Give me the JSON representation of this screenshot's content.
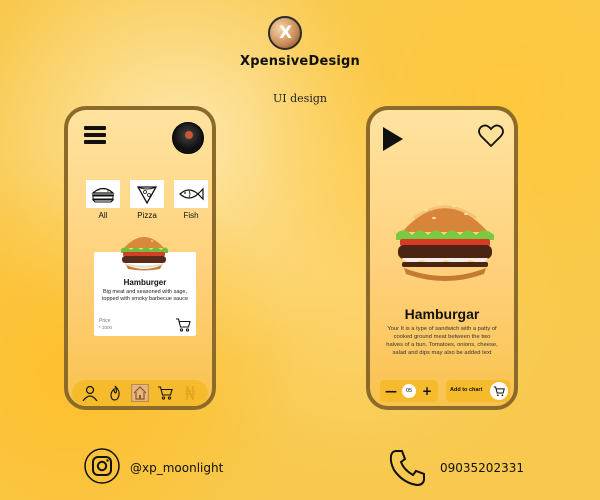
{
  "brand": {
    "logo_letter": "X",
    "name": "XpensiveDesign",
    "subtitle": "UI design"
  },
  "left_screen": {
    "menu_icon": "hamburger-menu-icon",
    "avatar_icon": "user-avatar",
    "categories": [
      {
        "label": "All",
        "icon": "burger-sketch-icon"
      },
      {
        "label": "Pizza",
        "icon": "pizza-slice-icon"
      },
      {
        "label": "Fish",
        "icon": "fish-icon"
      }
    ],
    "card": {
      "title": "Hamburger",
      "description": "Big meat and seasoned with sage, topped with smoky barbecue sauce",
      "price_label": "Price",
      "price_value": "* 2000",
      "cart_icon": "shopping-cart-icon"
    },
    "bottom_nav": [
      "user-icon",
      "fire-icon",
      "home-icon",
      "shopping-cart-icon",
      "naira-currency-icon"
    ],
    "active_nav": "home-icon"
  },
  "right_screen": {
    "play_icon": "play-icon",
    "heart_icon": "heart-icon",
    "product_title": "Hamburgar",
    "product_description": "Your It is a type of sandwich with a patty of cooked ground meat between the two halves of a bun. Tomatoes, onions, cheese, salad and dips may also be added text",
    "quantity": {
      "minus_label": "—",
      "value": "05",
      "plus_label": "+"
    },
    "add_to_cart_label": "Add to chart"
  },
  "contacts": {
    "instagram_handle": "@xp_moonlight",
    "phone_number": "09035202331"
  },
  "colors": {
    "accent": "#f6bb2d",
    "frame": "#8b6a2a",
    "text": "#111111"
  }
}
